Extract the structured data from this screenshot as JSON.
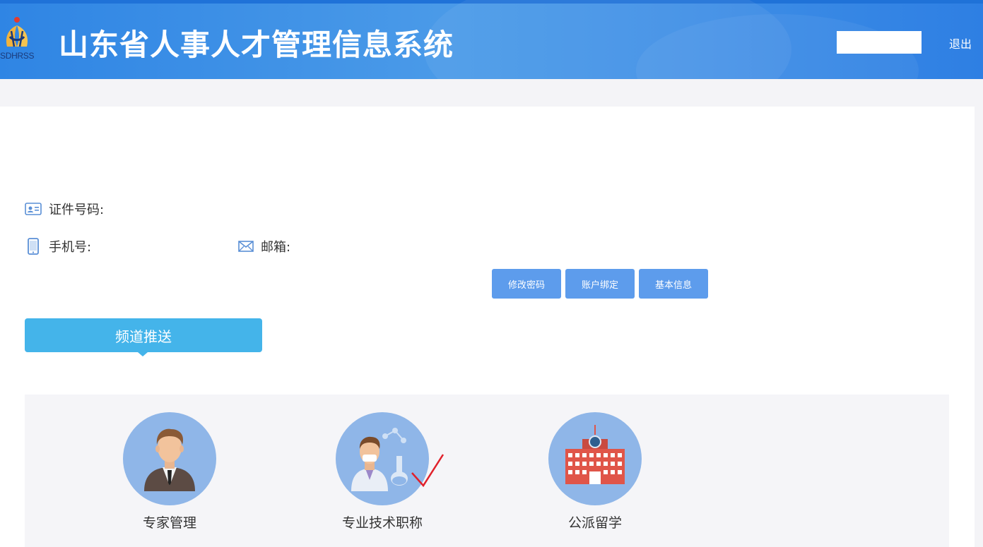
{
  "header": {
    "logo_text": "SDHRSS",
    "title": "山东省人事人才管理信息系统",
    "logout_label": "退出",
    "user_name": ""
  },
  "profile": {
    "id_label": "证件号码:",
    "id_value": "",
    "phone_label": "手机号:",
    "phone_value": "",
    "email_label": "邮箱:",
    "email_value": ""
  },
  "actions": {
    "change_password": "修改密码",
    "account_binding": "账户绑定",
    "basic_info": "基本信息"
  },
  "channel": {
    "title": "频道推送"
  },
  "tiles": [
    {
      "label": "专家管理",
      "icon": "expert-person-icon"
    },
    {
      "label": "专业技术职称",
      "icon": "scientist-icon",
      "checked": true
    },
    {
      "label": "公派留学",
      "icon": "school-building-icon"
    }
  ],
  "colors": {
    "header_blue": "#3f8fe6",
    "button_blue": "#5d9cec",
    "channel_blue": "#44b4ea",
    "tile_circle": "#8fb6e8",
    "check_red": "#e0212b"
  }
}
